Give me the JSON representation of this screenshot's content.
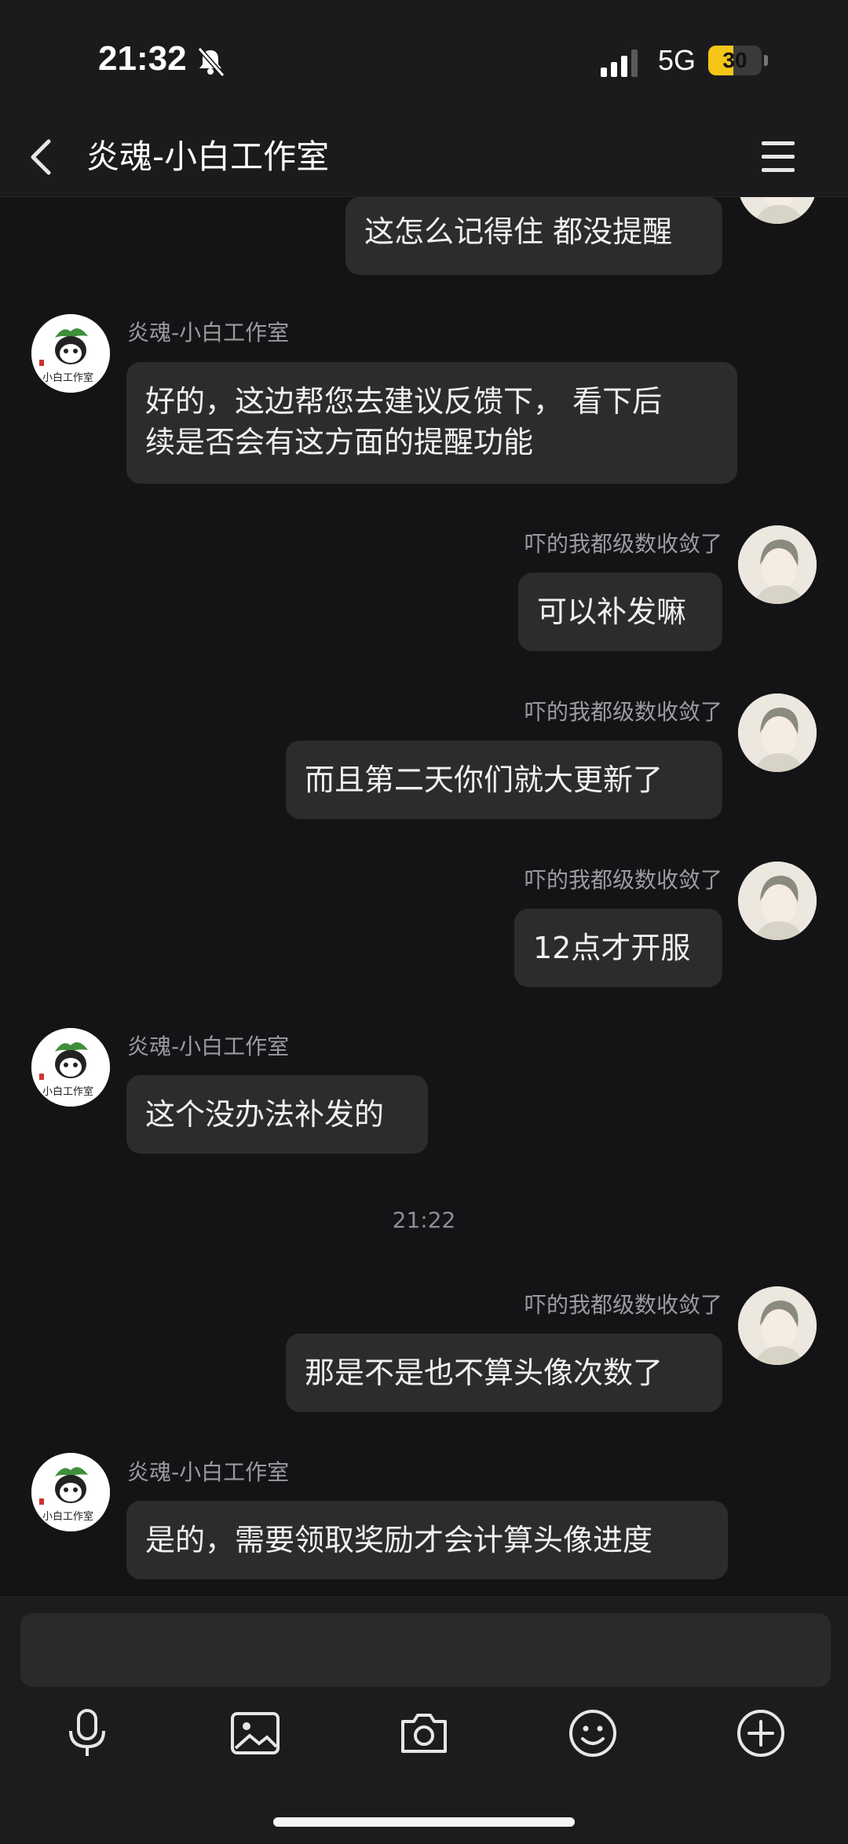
{
  "status_bar": {
    "time": "21:32",
    "network": "5G",
    "battery_level": "30",
    "battery_fraction": 0.3,
    "icons": [
      "bell-slash-icon",
      "signal-icon",
      "battery-icon"
    ]
  },
  "header": {
    "title": "炎魂-小白工作室",
    "icons": [
      "back-chevron-icon",
      "menu-icon"
    ]
  },
  "chat": {
    "messages": [
      {
        "side": "right",
        "sender": "",
        "lines": [
          "这怎么记得住 都没提醒"
        ]
      },
      {
        "side": "left",
        "sender": "炎魂-小白工作室",
        "lines": [
          "好的，这边帮您去建议反馈下， 看下后",
          "续是否会有这方面的提醒功能"
        ]
      },
      {
        "side": "right",
        "sender": "吓的我都级数收敛了",
        "lines": [
          "可以补发嘛"
        ]
      },
      {
        "side": "right",
        "sender": "吓的我都级数收敛了",
        "lines": [
          "而且第二天你们就大更新了"
        ]
      },
      {
        "side": "right",
        "sender": "吓的我都级数收敛了",
        "lines": [
          "12点才开服"
        ]
      },
      {
        "side": "left",
        "sender": "炎魂-小白工作室",
        "lines": [
          "这个没办法补发的"
        ]
      },
      {
        "side": "right",
        "sender": "吓的我都级数收敛了",
        "lines": [
          "那是不是也不算头像次数了"
        ]
      },
      {
        "side": "left",
        "sender": "炎魂-小白工作室",
        "lines": [
          "是的，需要领取奖励才会计算头像进度"
        ]
      }
    ],
    "timestamp": "21:22",
    "shop_avatar_text": "小白工作室"
  },
  "input_bar": {
    "placeholder": "",
    "tools": [
      "microphone-icon",
      "image-icon",
      "camera-icon",
      "emoji-icon",
      "plus-circle-icon"
    ]
  },
  "colors": {
    "background": "#141416",
    "bubble": "#2c2c2e",
    "battery": "#f5c518",
    "secondary_text": "#9b9b9f"
  }
}
